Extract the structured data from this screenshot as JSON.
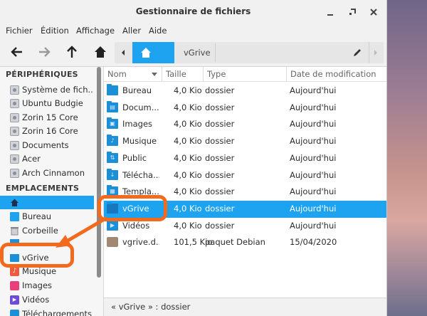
{
  "window": {
    "title": "Gestionnaire de fichiers",
    "controls": [
      "minimize",
      "maximize",
      "close"
    ]
  },
  "menubar": [
    "Fichier",
    "Édition",
    "Affichage",
    "Aller",
    "Aide"
  ],
  "toolbar": {
    "buttons": [
      "back-arrow-icon",
      "forward-arrow-icon",
      "up-arrow-icon",
      "home-icon"
    ]
  },
  "pathbar": {
    "current": "vGrive"
  },
  "sidebar": {
    "devices_heading": "PÉRIPHÉRIQUES",
    "devices": [
      "Système de fich...",
      "Ubuntu Budgie",
      "Zorin 15 Core",
      "Zorin 16 Core",
      "Documents",
      "Acer",
      "Arch Cinnamon"
    ],
    "places_heading": "EMPLACEMENTS",
    "places": [
      {
        "label": "",
        "icon": "home-icon",
        "active": true
      },
      {
        "label": "Bureau",
        "icon": "desktop-folder-icon"
      },
      {
        "label": "Corbeille",
        "icon": "trash-icon"
      },
      {
        "label": "",
        "icon": "folder-icon"
      },
      {
        "label": "vGrive",
        "icon": "folder-icon"
      },
      {
        "label": "Musique",
        "icon": "music-icon"
      },
      {
        "label": "Images",
        "icon": "images-icon"
      },
      {
        "label": "Vidéos",
        "icon": "videos-icon"
      },
      {
        "label": "Téléchargements",
        "icon": "download-icon"
      }
    ]
  },
  "filelist": {
    "columns": [
      "Nom",
      "Taille",
      "Type",
      "Date de modification"
    ],
    "rows": [
      {
        "name": "Bureau",
        "size": "4,0 Kio",
        "type": "dossier",
        "date": "Aujourd'hui",
        "glyph": ""
      },
      {
        "name": "Docum...",
        "size": "4,0 Kio",
        "type": "dossier",
        "date": "Aujourd'hui",
        "glyph": "▤"
      },
      {
        "name": "Images",
        "size": "4,0 Kio",
        "type": "dossier",
        "date": "Aujourd'hui",
        "glyph": "▣"
      },
      {
        "name": "Musique",
        "size": "4,0 Kio",
        "type": "dossier",
        "date": "Aujourd'hui",
        "glyph": "♪"
      },
      {
        "name": "Public",
        "size": "4,0 Kio",
        "type": "dossier",
        "date": "Aujourd'hui",
        "glyph": "⇅"
      },
      {
        "name": "Télécha...",
        "size": "4,0 Kio",
        "type": "dossier",
        "date": "Aujourd'hui",
        "glyph": "↓"
      },
      {
        "name": "Templa...",
        "size": "4,0 Kio",
        "type": "dossier",
        "date": "Aujourd'hui",
        "glyph": "▦"
      },
      {
        "name": "vGrive",
        "size": "4,0 Kio",
        "type": "dossier",
        "date": "Aujourd'hui",
        "glyph": "",
        "selected": true
      },
      {
        "name": "Vidéos",
        "size": "4,0 Kio",
        "type": "dossier",
        "date": "Aujourd'hui",
        "glyph": "▶"
      },
      {
        "name": "vgrive.d...",
        "size": "101,5 Kio",
        "type": "paquet Debian",
        "date": "15/04/2020",
        "glyph": "",
        "package": true
      }
    ]
  },
  "statusbar": {
    "text": "« vGrive » : dossier"
  },
  "colors": {
    "accent": "#1ea3f0",
    "annotation": "#f26a1e",
    "folder": "#1d8fd6"
  }
}
